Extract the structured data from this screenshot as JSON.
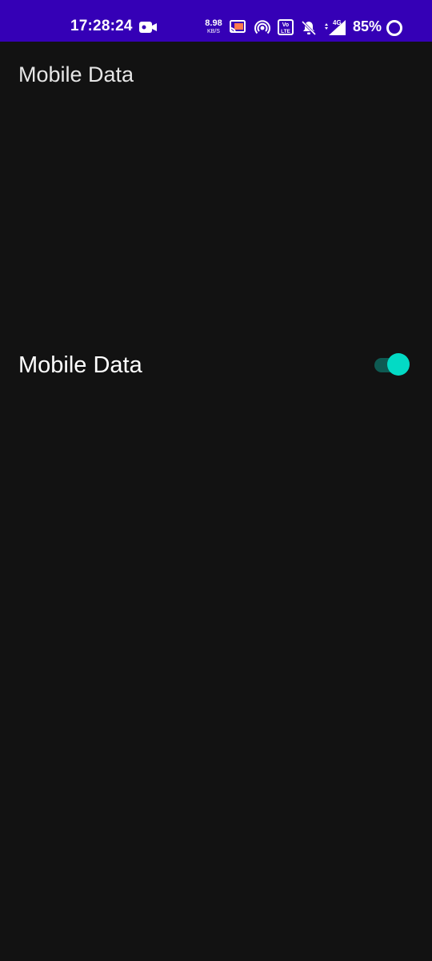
{
  "status_bar": {
    "time": "17:28:24",
    "net_speed_value": "8.98",
    "net_speed_unit": "KB/S",
    "battery_percent": "85%",
    "network_type": "4G",
    "volte_label": "Vo LTE",
    "icons": [
      "video-camera-icon",
      "cast-icon",
      "hotspot-icon",
      "volte-icon",
      "bell-off-icon",
      "signal-icon",
      "battery-ring-icon"
    ]
  },
  "header": {
    "title": "Mobile Data"
  },
  "settings": {
    "mobile_data": {
      "label": "Mobile Data",
      "enabled": true
    }
  },
  "colors": {
    "status_bar_bg": "#3500B6",
    "background": "#121212",
    "toggle_thumb": "#03DAC5",
    "toggle_track": "#0E5A52"
  }
}
